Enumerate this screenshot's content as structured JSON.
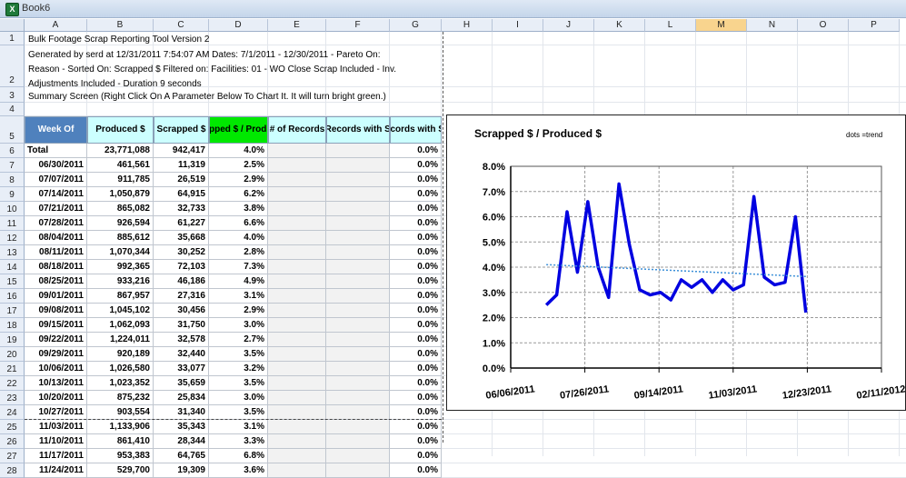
{
  "window": {
    "title": "Book6"
  },
  "columns": [
    "A",
    "B",
    "C",
    "D",
    "E",
    "F",
    "G",
    "H",
    "I",
    "J",
    "K",
    "L",
    "M",
    "N",
    "O",
    "P"
  ],
  "selected_column": "M",
  "info": {
    "line1": "Bulk Footage Scrap Reporting Tool Version 2",
    "line2a": "Generated by serd at 12/31/2011 7:54:07 AM  Dates: 7/1/2011 - 12/30/2011 - Pareto On:",
    "line2b": "Reason - Sorted On: Scrapped $  Filtered on:   Facilities: 01   - WO Close Scrap Included - Inv.",
    "line2c": "Adjustments Included - Duration 9 seconds",
    "line3": "Summary Screen (Right Click On A Parameter Below To Chart It.  It will turn bright green.)"
  },
  "table": {
    "headers": [
      "Week Of",
      "Produced $",
      "Scrapped $",
      "Scrapped $ / Produced",
      "# of Records",
      "# of Records with Scrap",
      "% Records with Scrap"
    ],
    "rows": [
      [
        "Total",
        "23,771,088",
        "942,417",
        "4.0%",
        "",
        "",
        "0.0%"
      ],
      [
        "06/30/2011",
        "461,561",
        "11,319",
        "2.5%",
        "",
        "",
        "0.0%"
      ],
      [
        "07/07/2011",
        "911,785",
        "26,519",
        "2.9%",
        "",
        "",
        "0.0%"
      ],
      [
        "07/14/2011",
        "1,050,879",
        "64,915",
        "6.2%",
        "",
        "",
        "0.0%"
      ],
      [
        "07/21/2011",
        "865,082",
        "32,733",
        "3.8%",
        "",
        "",
        "0.0%"
      ],
      [
        "07/28/2011",
        "926,594",
        "61,227",
        "6.6%",
        "",
        "",
        "0.0%"
      ],
      [
        "08/04/2011",
        "885,612",
        "35,668",
        "4.0%",
        "",
        "",
        "0.0%"
      ],
      [
        "08/11/2011",
        "1,070,344",
        "30,252",
        "2.8%",
        "",
        "",
        "0.0%"
      ],
      [
        "08/18/2011",
        "992,365",
        "72,103",
        "7.3%",
        "",
        "",
        "0.0%"
      ],
      [
        "08/25/2011",
        "933,216",
        "46,186",
        "4.9%",
        "",
        "",
        "0.0%"
      ],
      [
        "09/01/2011",
        "867,957",
        "27,316",
        "3.1%",
        "",
        "",
        "0.0%"
      ],
      [
        "09/08/2011",
        "1,045,102",
        "30,456",
        "2.9%",
        "",
        "",
        "0.0%"
      ],
      [
        "09/15/2011",
        "1,062,093",
        "31,750",
        "3.0%",
        "",
        "",
        "0.0%"
      ],
      [
        "09/22/2011",
        "1,224,011",
        "32,578",
        "2.7%",
        "",
        "",
        "0.0%"
      ],
      [
        "09/29/2011",
        "920,189",
        "32,440",
        "3.5%",
        "",
        "",
        "0.0%"
      ],
      [
        "10/06/2011",
        "1,026,580",
        "33,077",
        "3.2%",
        "",
        "",
        "0.0%"
      ],
      [
        "10/13/2011",
        "1,023,352",
        "35,659",
        "3.5%",
        "",
        "",
        "0.0%"
      ],
      [
        "10/20/2011",
        "875,232",
        "25,834",
        "3.0%",
        "",
        "",
        "0.0%"
      ],
      [
        "10/27/2011",
        "903,554",
        "31,340",
        "3.5%",
        "",
        "",
        "0.0%"
      ],
      [
        "11/03/2011",
        "1,133,906",
        "35,343",
        "3.1%",
        "",
        "",
        "0.0%"
      ],
      [
        "11/10/2011",
        "861,410",
        "28,344",
        "3.3%",
        "",
        "",
        "0.0%"
      ],
      [
        "11/17/2011",
        "953,383",
        "64,765",
        "6.8%",
        "",
        "",
        "0.0%"
      ],
      [
        "11/24/2011",
        "529,700",
        "19,309",
        "3.6%",
        "",
        "",
        "0.0%"
      ]
    ]
  },
  "chart_data": {
    "type": "line",
    "title": "Scrapped $ / Produced $",
    "annotation": "dots =trend",
    "ylim": [
      0.0,
      0.08
    ],
    "yticks": [
      "0.0%",
      "1.0%",
      "2.0%",
      "3.0%",
      "4.0%",
      "5.0%",
      "6.0%",
      "7.0%",
      "8.0%"
    ],
    "xticks": [
      "06/06/2011",
      "07/26/2011",
      "09/14/2011",
      "11/03/2011",
      "12/23/2011",
      "02/11/2012"
    ],
    "x": [
      "06/30/2011",
      "07/07/2011",
      "07/14/2011",
      "07/21/2011",
      "07/28/2011",
      "08/04/2011",
      "08/11/2011",
      "08/18/2011",
      "08/25/2011",
      "09/01/2011",
      "09/08/2011",
      "09/15/2011",
      "09/22/2011",
      "09/29/2011",
      "10/06/2011",
      "10/13/2011",
      "10/20/2011",
      "10/27/2011",
      "11/03/2011",
      "11/10/2011",
      "11/17/2011",
      "11/24/2011",
      "12/01/2011",
      "12/08/2011",
      "12/15/2011",
      "12/22/2011"
    ],
    "series": [
      {
        "values": [
          0.025,
          0.029,
          0.062,
          0.038,
          0.066,
          0.04,
          0.028,
          0.073,
          0.049,
          0.031,
          0.029,
          0.03,
          0.027,
          0.035,
          0.032,
          0.035,
          0.03,
          0.035,
          0.031,
          0.033,
          0.068,
          0.036,
          0.033,
          0.034,
          0.06,
          0.022
        ],
        "color": "#0000e0"
      },
      {
        "values": [
          0.041,
          0.0363
        ],
        "color": "#3b8fd8",
        "style": "dotted"
      }
    ],
    "grid": true,
    "legend": "none"
  }
}
